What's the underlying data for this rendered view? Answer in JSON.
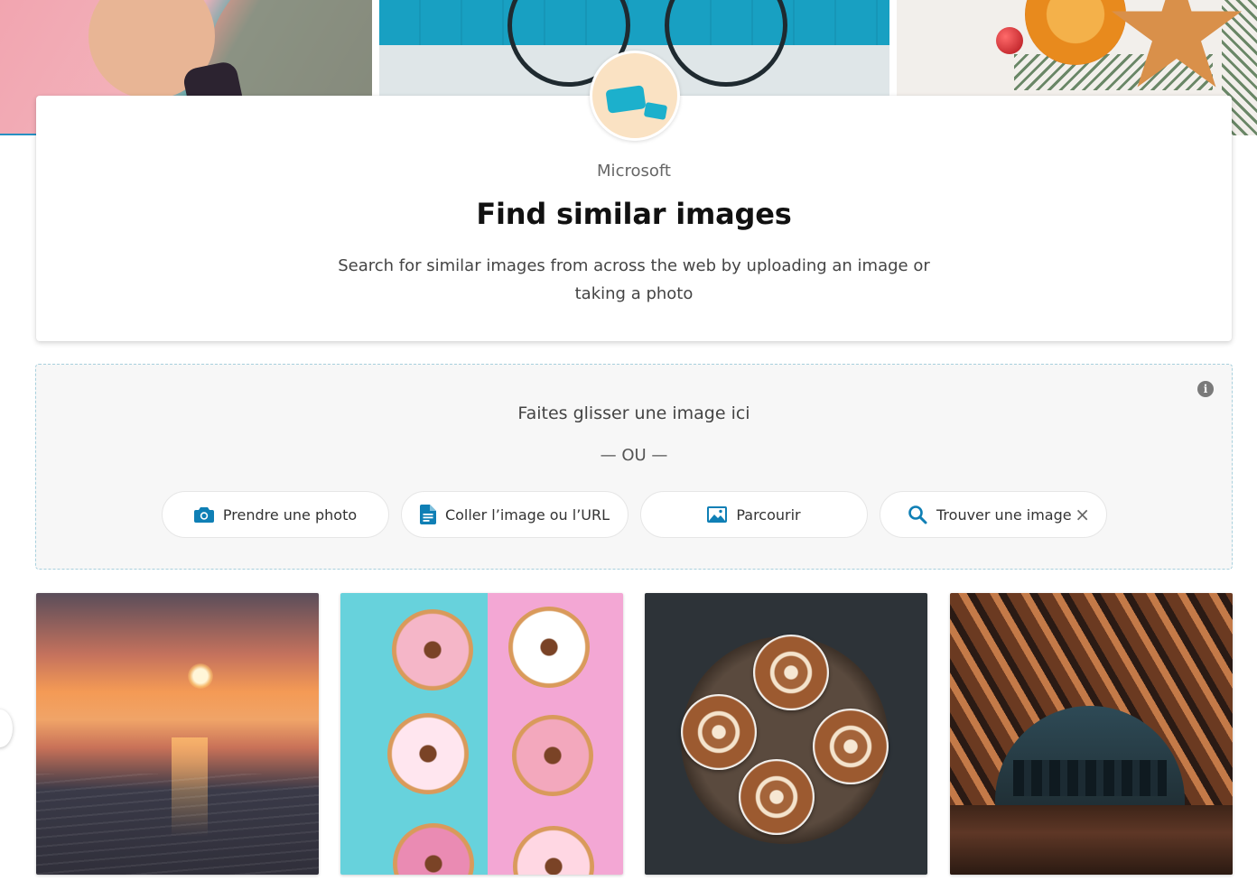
{
  "app": {
    "publisher": "Microsoft",
    "title": "Find similar images",
    "description": "Search for similar images from across the web by uploading an image or taking a photo"
  },
  "dropzone": {
    "prompt": "Faites glisser une image ici",
    "or_separator": "— OU —",
    "buttons": [
      {
        "label": "Prendre une photo",
        "icon": "camera-icon"
      },
      {
        "label": "Coller l’image ou l’URL",
        "icon": "document-icon"
      },
      {
        "label": "Parcourir",
        "icon": "image-icon"
      },
      {
        "label": "Trouver une image",
        "icon": "search-icon",
        "close_icon": "×"
      }
    ],
    "info_icon": "i"
  },
  "colors": {
    "accent": "#0f7fb5",
    "dropzone_border": "#a8d0dd",
    "dropzone_bg": "#f7f7f7"
  },
  "sample_images": [
    {
      "subject": "sunset-over-sea"
    },
    {
      "subject": "donuts"
    },
    {
      "subject": "latte-art"
    },
    {
      "subject": "wooden-pavilion"
    }
  ]
}
